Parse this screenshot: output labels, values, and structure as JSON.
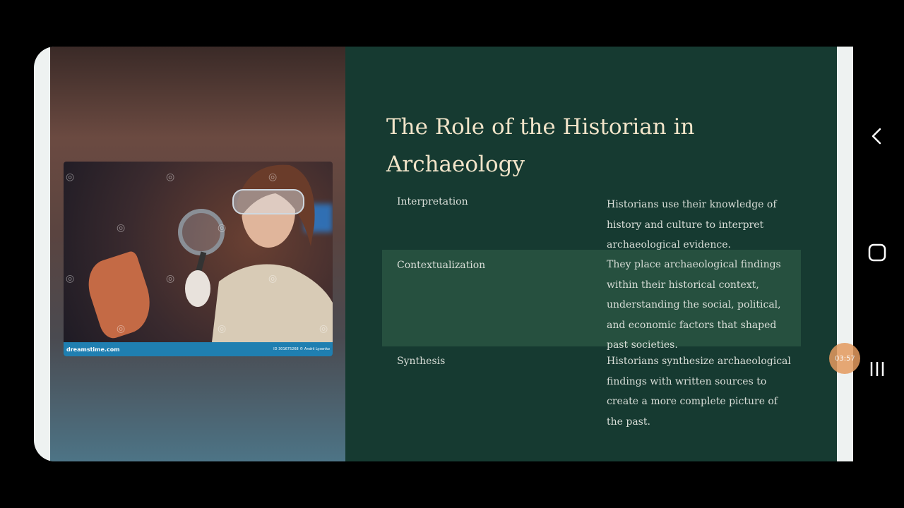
{
  "slide": {
    "title": "The Role of the Historian in Archaeology",
    "rows": [
      {
        "term": "Interpretation",
        "description": "Historians use their knowledge of history and culture to interpret archaeological evidence."
      },
      {
        "term": "Contextualization",
        "description": "They place archaeological findings within their historical context, understanding the social, political, and economic factors that shaped past societies."
      },
      {
        "term": "Synthesis",
        "description": "Historians synthesize archaeological findings with written sources to create a more complete picture of the past."
      }
    ]
  },
  "photo": {
    "brand": "dreamstime.com",
    "image_id": "ID 301675268 © Andrii Lysenko",
    "watermark_symbol": "◎"
  },
  "overlay": {
    "timer": "03:57"
  },
  "nav": {
    "back_icon": "chevron-left-icon",
    "home_icon": "home-square-icon",
    "recents_icon": "recent-apps-icon"
  },
  "colors": {
    "slide_bg": "#163a31",
    "highlight_row": "#26503f",
    "title_text": "#f1e4c9",
    "body_text": "#d9ded8",
    "credit_bar": "#1f7fb1",
    "timer_bubble": "#e49a5f"
  }
}
